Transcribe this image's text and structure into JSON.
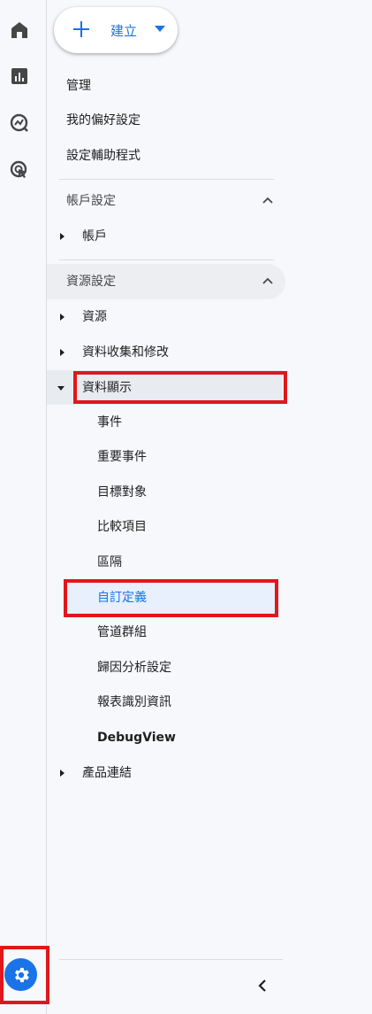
{
  "create_button": {
    "label": "建立"
  },
  "top_items": [
    "管理",
    "我的偏好設定",
    "設定輔助程式"
  ],
  "account_section": {
    "title": "帳戶設定",
    "items": [
      "帳戶"
    ]
  },
  "property_section": {
    "title": "資源設定",
    "items": [
      "資源",
      "資料收集和修改"
    ],
    "expanded_group": {
      "label": "資料顯示",
      "children": [
        "事件",
        "重要事件",
        "目標對象",
        "比較項目",
        "區隔",
        "自訂定義",
        "管道群組",
        "歸因分析設定",
        "報表識別資訊",
        "DebugView"
      ],
      "selected": "自訂定義"
    },
    "after_items": [
      "產品連結"
    ]
  },
  "icons": [
    "home-icon",
    "reports-icon",
    "explore-icon",
    "advertising-icon",
    "admin-gear-icon",
    "collapse-chevron-icon"
  ],
  "colors": {
    "accent": "#1a73e8",
    "highlight_red": "#e0171c",
    "selected_bg": "#e8f0fe"
  }
}
